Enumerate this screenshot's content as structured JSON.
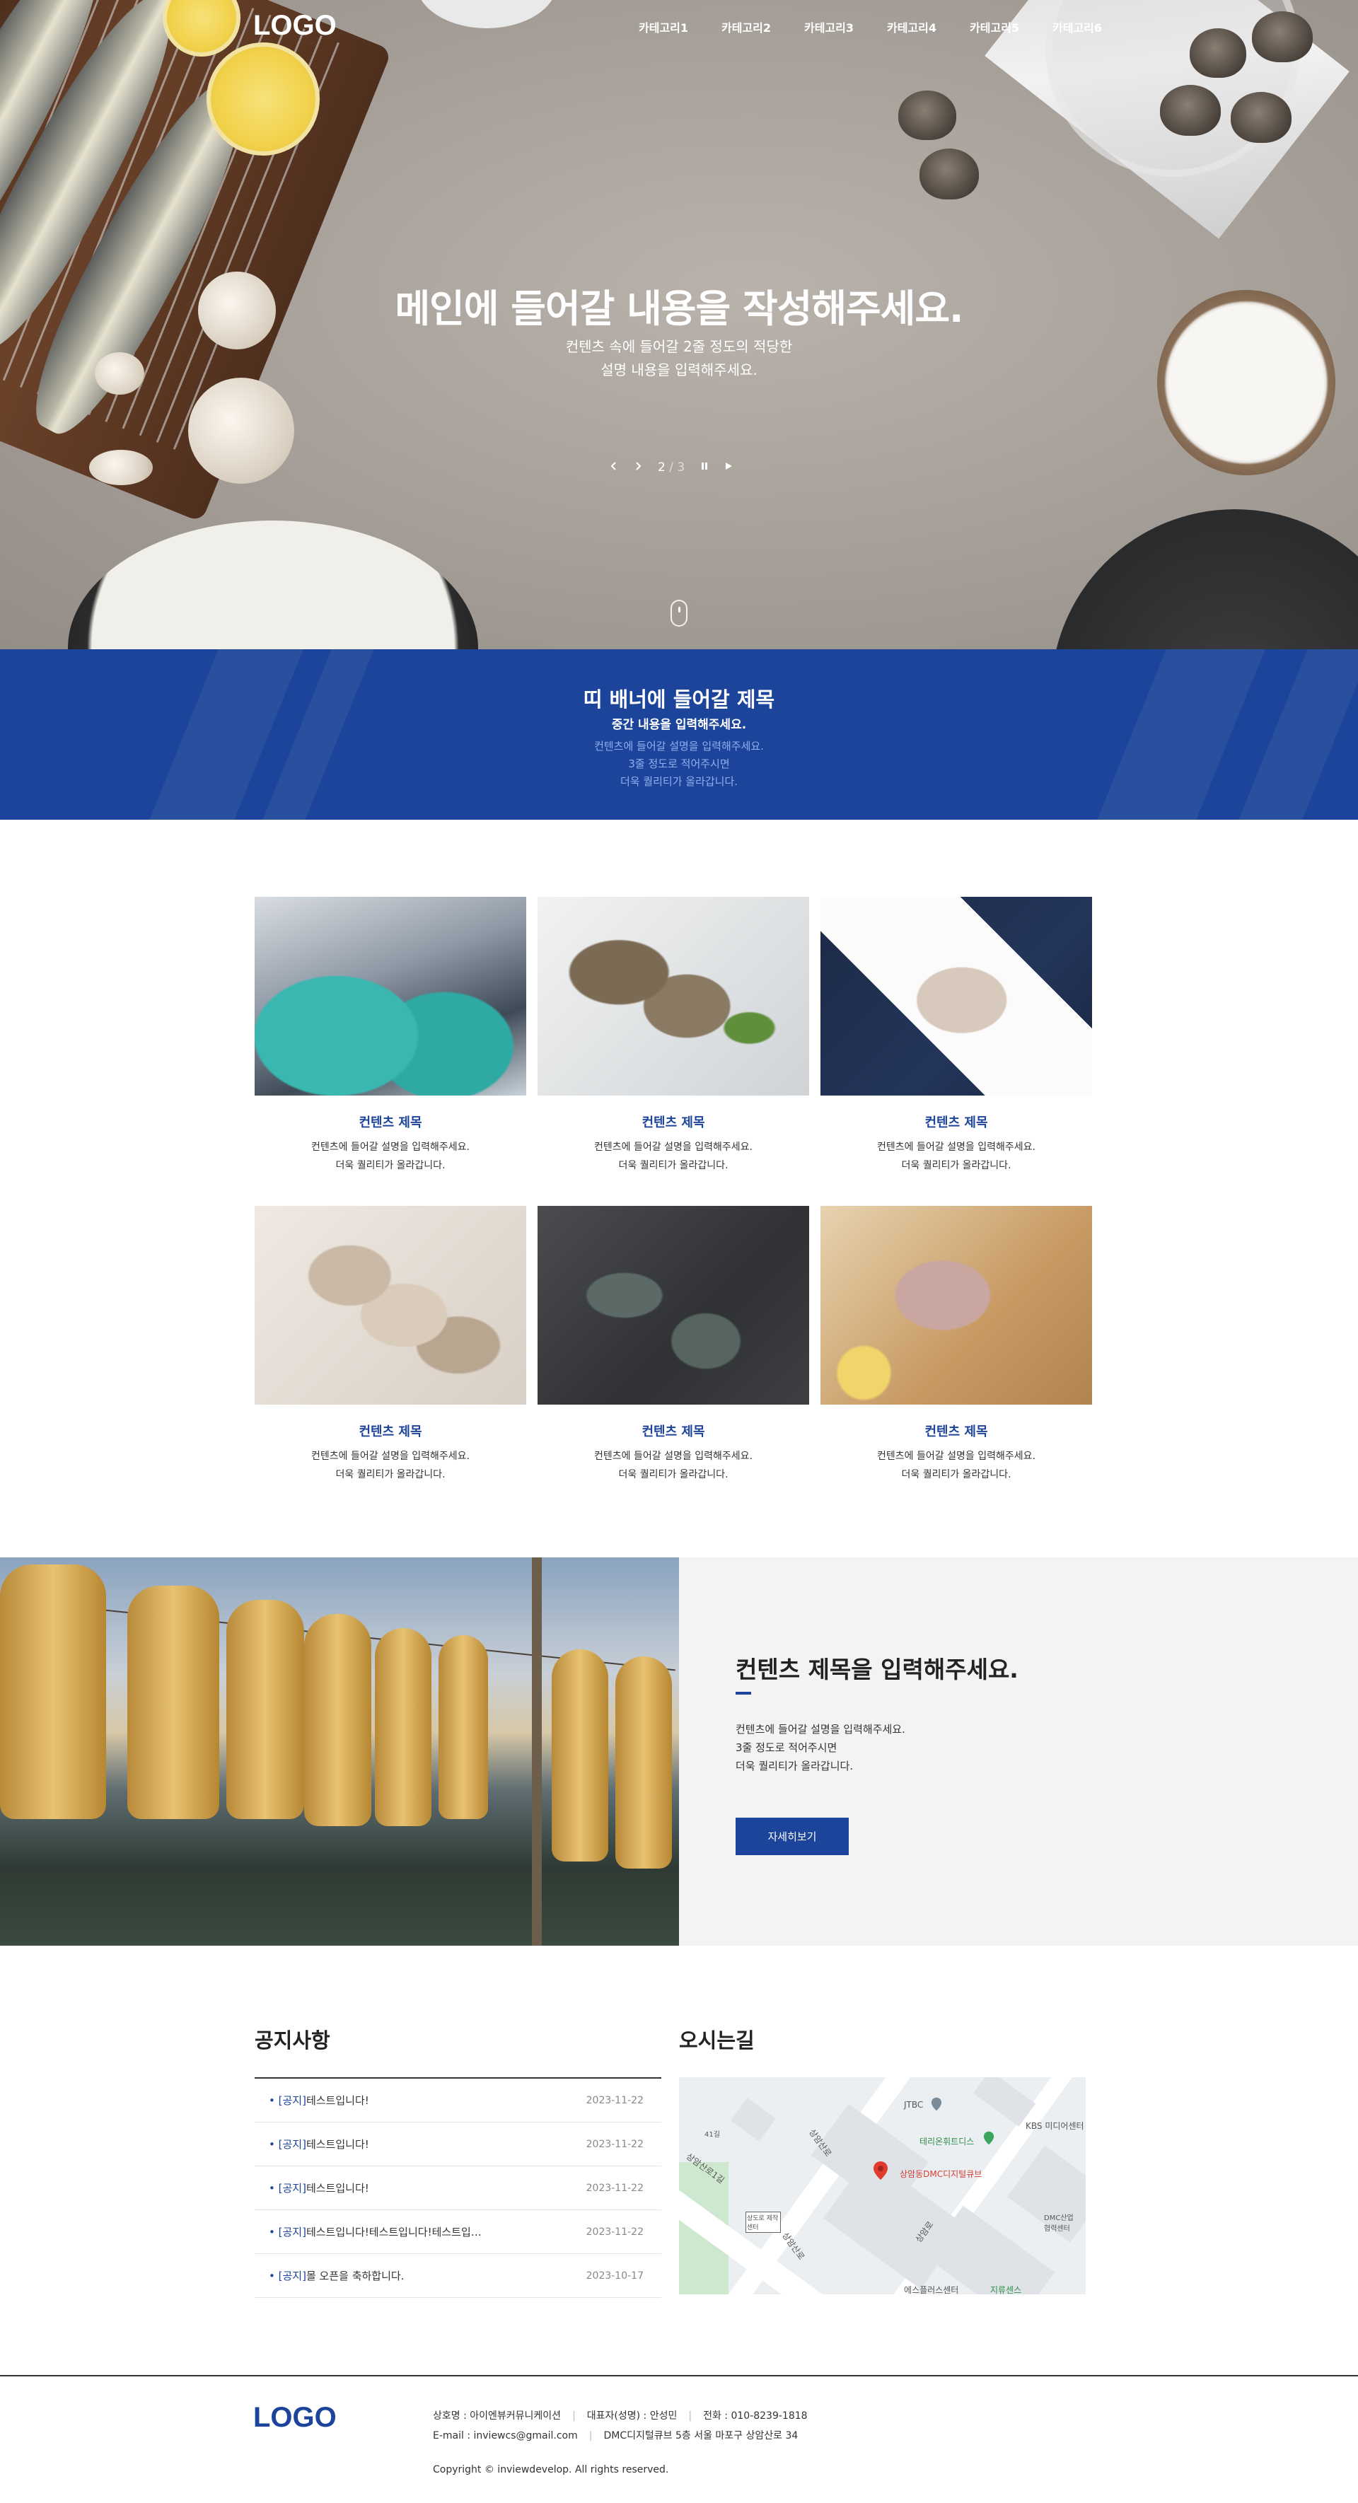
{
  "header": {
    "logo": "LOGO",
    "nav": [
      "카테고리1",
      "카테고리2",
      "카테고리3",
      "카테고리4",
      "카테고리5",
      "카테고리6"
    ]
  },
  "hero": {
    "title": "메인에 들어갈 내용을 작성해주세요.",
    "desc_line1": "컨텐츠 속에 들어갈 2줄 정도의 적당한",
    "desc_line2": "설명 내용을 입력해주세요.",
    "current_slide": "2",
    "total_slides": "/ 3"
  },
  "band": {
    "title": "띠 배너에 들어갈 제목",
    "subtitle": "중간 내용을 입력해주세요.",
    "desc_line1": "컨텐츠에 들어갈 설명을 입력해주세요.",
    "desc_line2": "3줄 정도로 적어주시면",
    "desc_line3": "더욱 퀄리티가 올라갑니다."
  },
  "cards": [
    {
      "title": "컨텐츠 제목",
      "line1": "컨텐츠에 들어갈 설명을 입력해주세요.",
      "line2": "더욱 퀄리티가 올라갑니다."
    },
    {
      "title": "컨텐츠 제목",
      "line1": "컨텐츠에 들어갈 설명을 입력해주세요.",
      "line2": "더욱 퀄리티가 올라갑니다."
    },
    {
      "title": "컨텐츠 제목",
      "line1": "컨텐츠에 들어갈 설명을 입력해주세요.",
      "line2": "더욱 퀄리티가 올라갑니다."
    },
    {
      "title": "컨텐츠 제목",
      "line1": "컨텐츠에 들어갈 설명을 입력해주세요.",
      "line2": "더욱 퀄리티가 올라갑니다."
    },
    {
      "title": "컨텐츠 제목",
      "line1": "컨텐츠에 들어갈 설명을 입력해주세요.",
      "line2": "더욱 퀄리티가 올라갑니다."
    },
    {
      "title": "컨텐츠 제목",
      "line1": "컨텐츠에 들어갈 설명을 입력해주세요.",
      "line2": "더욱 퀄리티가 올라갑니다."
    }
  ],
  "feature": {
    "title": "컨텐츠 제목을 입력해주세요.",
    "desc_line1": "컨텐츠에 들어갈 설명을 입력해주세요.",
    "desc_line2": "3줄 정도로 적어주시면",
    "desc_line3": "더욱 퀄리티가 올라갑니다.",
    "button": "자세히보기"
  },
  "notice": {
    "title": "공지사항",
    "items": [
      {
        "bullet": "•",
        "tag": "[공지]",
        "text": "테스트입니다!",
        "date": "2023-11-22"
      },
      {
        "bullet": "•",
        "tag": "[공지]",
        "text": "테스트입니다!",
        "date": "2023-11-22"
      },
      {
        "bullet": "•",
        "tag": "[공지]",
        "text": "테스트입니다!",
        "date": "2023-11-22"
      },
      {
        "bullet": "•",
        "tag": "[공지]",
        "text": "테스트입니다!테스트입니다!테스트입…",
        "date": "2023-11-22"
      },
      {
        "bullet": "•",
        "tag": "[공지]",
        "text": "몰 오픈을 축하합니다.",
        "date": "2023-10-17"
      }
    ]
  },
  "location": {
    "title": "오시는길",
    "labels": {
      "jtbc": "JTBC",
      "kbs": "KBS 미디어센터",
      "teleworld": "테리온휘트디스",
      "target": "상암동DMC디지털큐브",
      "dmc": "DMC산업 협력센터",
      "road1": "상암산로",
      "road2": "상암산로1길",
      "road3": "상암산로",
      "road4": "상암로",
      "num": "41길",
      "box": "상도로 제작센터",
      "bottom1": "에스플러스센터",
      "bottom2": "지류센스"
    }
  },
  "footer": {
    "logo": "LOGO",
    "company": "상호명 : 아이엔뷰커뮤니케이션",
    "ceo": "대표자(성명) : 안성민",
    "tel": "전화 : 010-8239-1818",
    "email": "E-mail : inviewcs@gmail.com",
    "address": "DMC디지털큐브 5층 서울 마포구 상암산로 34",
    "copyright": "Copyright © inviewdevelop. All rights reserved."
  }
}
